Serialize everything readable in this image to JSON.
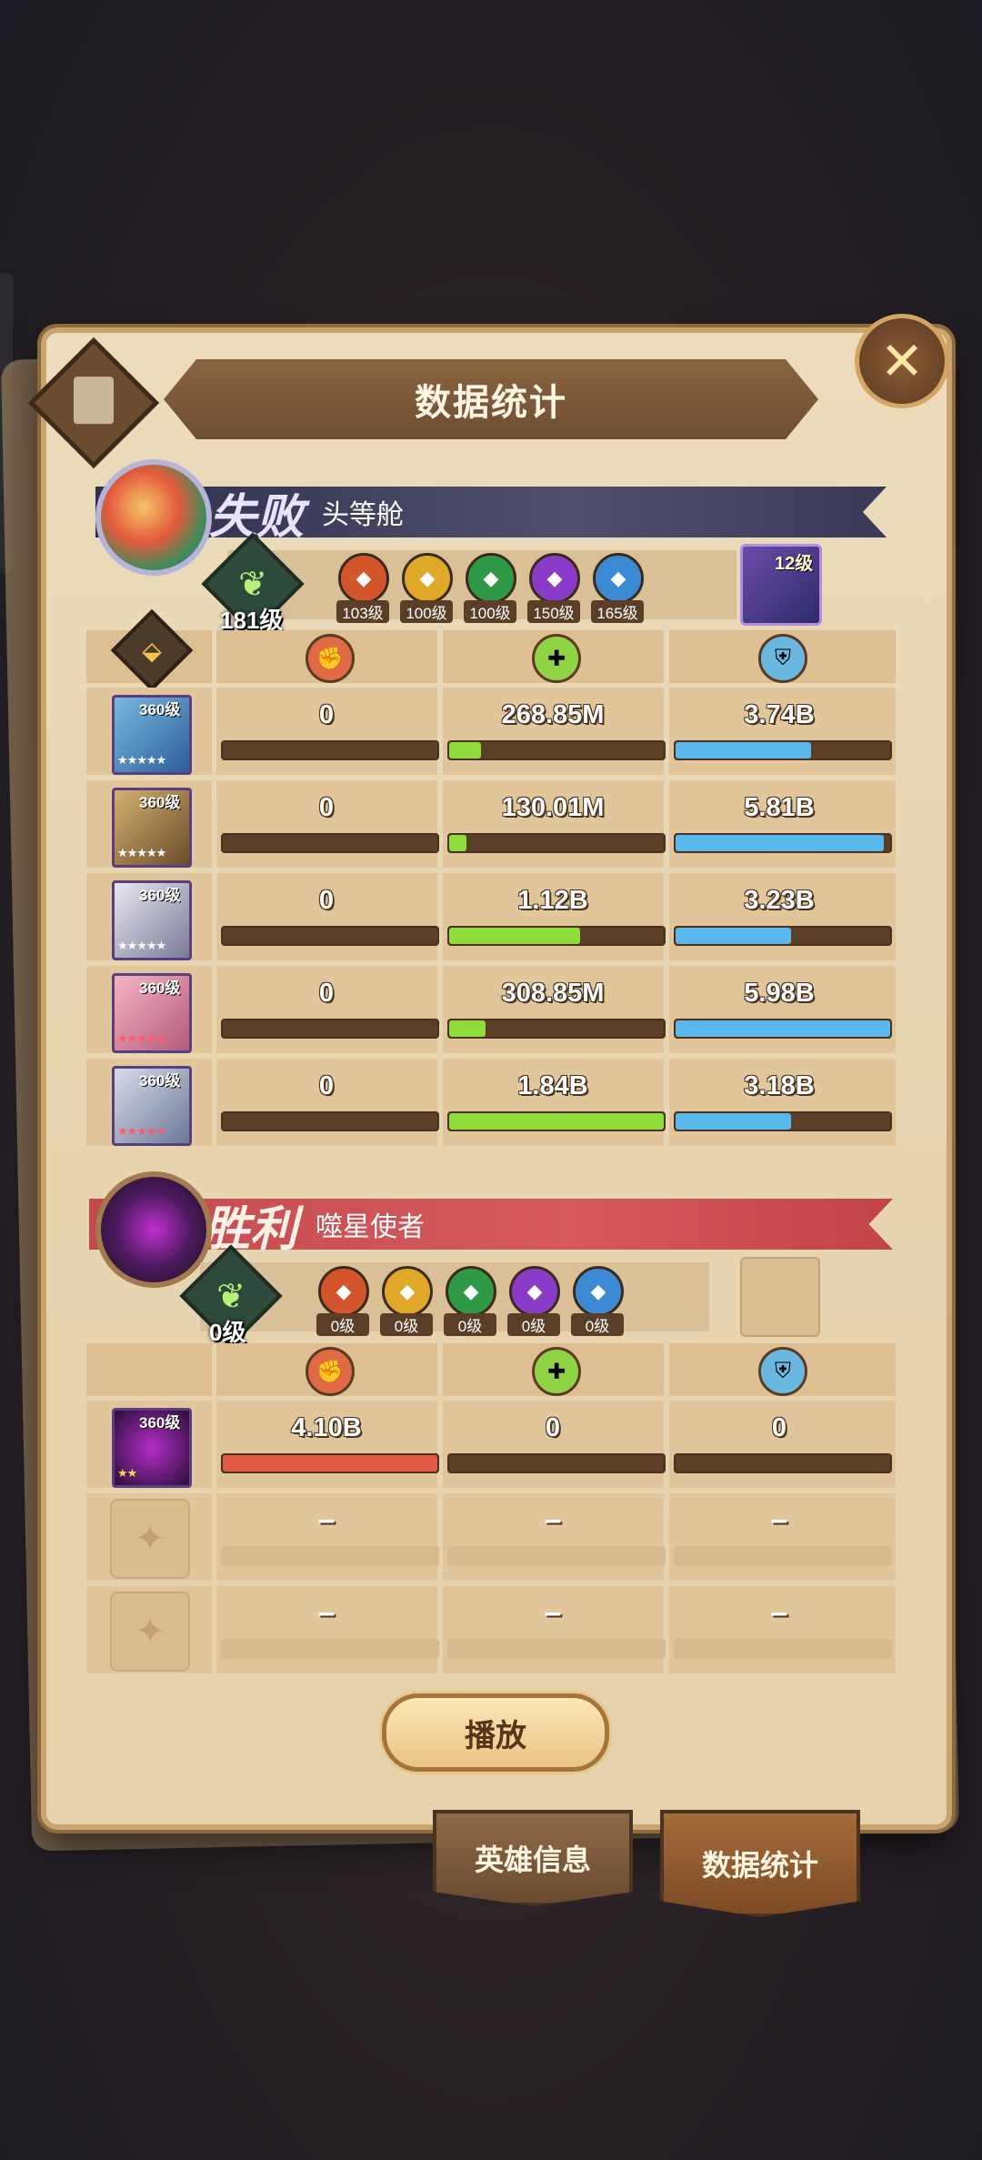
{
  "title": "数据统计",
  "close_icon": "close-icon",
  "team1": {
    "result": "失败",
    "player": "头等舱",
    "level": "181级",
    "gems": [
      {
        "icon": "fire-gem-icon",
        "color": "#d2552c",
        "level": "103级"
      },
      {
        "icon": "light-gem-icon",
        "color": "#e0a828",
        "level": "100级"
      },
      {
        "icon": "nature-gem-icon",
        "color": "#2f9a46",
        "level": "100级"
      },
      {
        "icon": "dark-gem-icon",
        "color": "#8a3cc8",
        "level": "150级"
      },
      {
        "icon": "water-gem-icon",
        "color": "#3c8ad4",
        "level": "165级"
      }
    ],
    "pet_level": "12级",
    "heroes": [
      {
        "level": "360级",
        "damage": "0",
        "damage_pct": 0,
        "heal": "268.85M",
        "heal_pct": 0.15,
        "block": "3.74B",
        "block_pct": 0.63
      },
      {
        "level": "360级",
        "damage": "0",
        "damage_pct": 0,
        "heal": "130.01M",
        "heal_pct": 0.08,
        "block": "5.81B",
        "block_pct": 0.97
      },
      {
        "level": "360级",
        "damage": "0",
        "damage_pct": 0,
        "heal": "1.12B",
        "heal_pct": 0.61,
        "block": "3.23B",
        "block_pct": 0.54
      },
      {
        "level": "360级",
        "damage": "0",
        "damage_pct": 0,
        "heal": "308.85M",
        "heal_pct": 0.17,
        "block": "5.98B",
        "block_pct": 1.0
      },
      {
        "level": "360级",
        "damage": "0",
        "damage_pct": 0,
        "heal": "1.84B",
        "heal_pct": 1.0,
        "block": "3.18B",
        "block_pct": 0.54
      }
    ]
  },
  "team2": {
    "result": "胜利",
    "player": "噬星使者",
    "level": "0级",
    "gems": [
      {
        "icon": "fire-gem-icon",
        "color": "#d2552c",
        "level": "0级"
      },
      {
        "icon": "light-gem-icon",
        "color": "#e0a828",
        "level": "0级"
      },
      {
        "icon": "nature-gem-icon",
        "color": "#2f9a46",
        "level": "0级"
      },
      {
        "icon": "dark-gem-icon",
        "color": "#8a3cc8",
        "level": "0级"
      },
      {
        "icon": "water-gem-icon",
        "color": "#3c8ad4",
        "level": "0级"
      }
    ],
    "heroes": [
      {
        "level": "360级",
        "damage": "4.10B",
        "damage_pct": 1.0,
        "heal": "0",
        "heal_pct": 0,
        "block": "0",
        "block_pct": 0
      }
    ],
    "empty_rows": [
      {
        "damage": "–",
        "heal": "–",
        "block": "–"
      },
      {
        "damage": "–",
        "heal": "–",
        "block": "–"
      }
    ]
  },
  "colors": {
    "damage_bar": "#e35b45",
    "heal_bar": "#8fdc3a",
    "block_bar": "#5ab8ec"
  },
  "play_button": "播放",
  "tabs": [
    "英雄信息",
    "数据统计"
  ]
}
